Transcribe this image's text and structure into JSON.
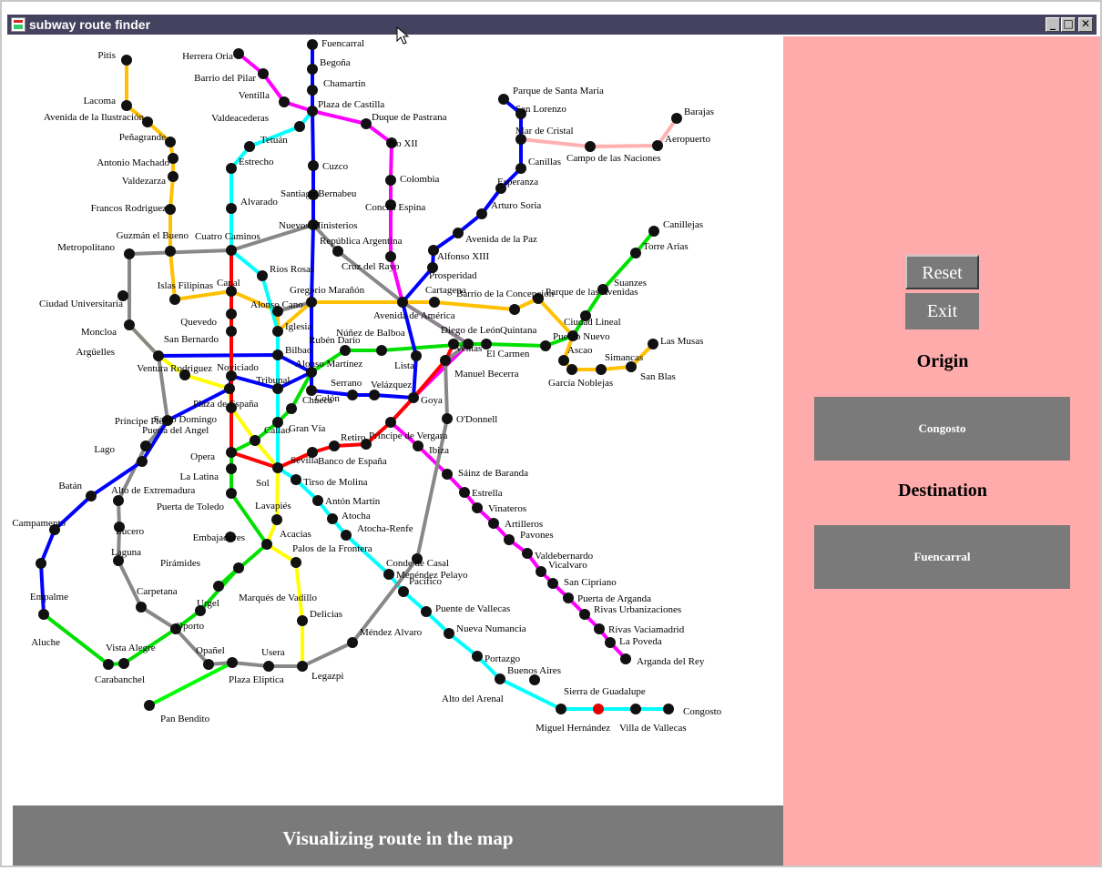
{
  "window": {
    "title": "subway route finder",
    "minimize_glyph": "_",
    "maximize_glyph": "□",
    "close_glyph": "✕"
  },
  "status": "Visualizing route in the map",
  "panel": {
    "reset_label": "Reset",
    "exit_label": "Exit",
    "origin_heading": "Origin",
    "origin_value": "Congosto",
    "destination_heading": "Destination",
    "destination_value": "Fuencarral"
  },
  "colors": {
    "sidebar": "#ffabab",
    "panel_gray": "#7a7a7a",
    "titlebar": "#44425e",
    "highlighted_station": "#e00000"
  },
  "highlighted_station": "Sierra de Guadalupe",
  "stations": [
    "Pitis",
    "Lacoma",
    "Avenida de la Ilustración",
    "Peñagrande",
    "Antonio Machado",
    "Valdezarza",
    "Francos Rodriguez",
    "Guzmán el Bueno",
    "Metropolitano",
    "Ciudad Universitaria",
    "Islas Filipinas",
    "Moncloa",
    "Argüelles",
    "Ventura Rodriguez",
    "Príncipe Pío",
    "Lago",
    "Batán",
    "Campamento",
    "Empalme",
    "Aluche",
    "Carabanchel",
    "Vista Alegre",
    "Pan Bendito",
    "Herrera Oria",
    "Barrio del Pilar",
    "Ventilla",
    "Valdeacederas",
    "Tetuán",
    "Estrecho",
    "Alvarado",
    "Cuatro Caminos",
    "Canal",
    "Quevedo",
    "San Bernardo",
    "Noviciado",
    "Plaza de España",
    "Santo Domingo",
    "Opera",
    "La Latina",
    "Puerta de Toledo",
    "Puerta del Angel",
    "Alto de Extremadura",
    "Lucero",
    "Laguna",
    "Carpetana",
    "Oporto",
    "Opañel",
    "Urgel",
    "Pirámides",
    "Marqués de Vadillo",
    "Embajadores",
    "Acacias",
    "Lavapiés",
    "Sol",
    "Callao",
    "Gran Vía",
    "Chueca",
    "Tribunal",
    "Bilbao",
    "Iglesia",
    "Alonso Cano",
    "Ríos Rosas",
    "Fuencarral",
    "Begoña",
    "Chamartín",
    "Plaza de Castilla",
    "Duque de Pastrana",
    "Pío XII",
    "Colombia",
    "Concha Espina",
    "Cuzco",
    "Santiago Bernabeu",
    "Nuevos Ministerios",
    "República Argentina",
    "Gregorio Marañón",
    "Cruz del Rayo",
    "Avenida de América",
    "Prosperidad",
    "Cartagena",
    "Alfonso XIII",
    "Avenida de la Paz",
    "Arturo Soria",
    "Esperanza",
    "Canillas",
    "Mar de Cristal",
    "San Lorenzo",
    "Parque de Santa María",
    "Campo de las Naciones",
    "Aeropuerto",
    "Barajas",
    "Canillejas",
    "Torre Arias",
    "Suanzes",
    "Ciudad Lineal",
    "Pueblo Nuevo",
    "Quintana",
    "Barrio de la Concepción",
    "Parque de las Avenidas",
    "Diego de León",
    "Núñez de Balboa",
    "Rubén Darío",
    "Alonso Martínez",
    "Colón",
    "Serrano",
    "Velázquez",
    "Lista",
    "Goya",
    "Manuel Becerra",
    "Ventas",
    "El Carmen",
    "Ascao",
    "García Noblejas",
    "Simancas",
    "San Blas",
    "Las Musas",
    "Retiro",
    "Banco de España",
    "Sevilla",
    "Tirso de Molina",
    "Antón Martín",
    "Atocha",
    "Atocha-Renfe",
    "Palos de la Frontera",
    "Delicias",
    "Legazpi",
    "Usera",
    "Plaza Elíptica",
    "Méndez Alvaro",
    "Pacífico",
    "Menéndez Pelayo",
    "Conde de Casal",
    "O'Donnell",
    "Príncipe de Vergara",
    "Ibiza",
    "Sáinz de Baranda",
    "Estrella",
    "Vinateros",
    "Artilleros",
    "Pavones",
    "Valdebernardo",
    "Vicalvaro",
    "San Cipriano",
    "Puerta de Arganda",
    "Rivas Urbanizaciones",
    "Rivas Vaciamadrid",
    "La Poveda",
    "Arganda del Rey",
    "Puente de Vallecas",
    "Nueva Numancia",
    "Portazgo",
    "Buenos Aires",
    "Alto del Arenal",
    "Miguel Hernández",
    "Sierra de Guadalupe",
    "Villa de Vallecas",
    "Congosto"
  ]
}
